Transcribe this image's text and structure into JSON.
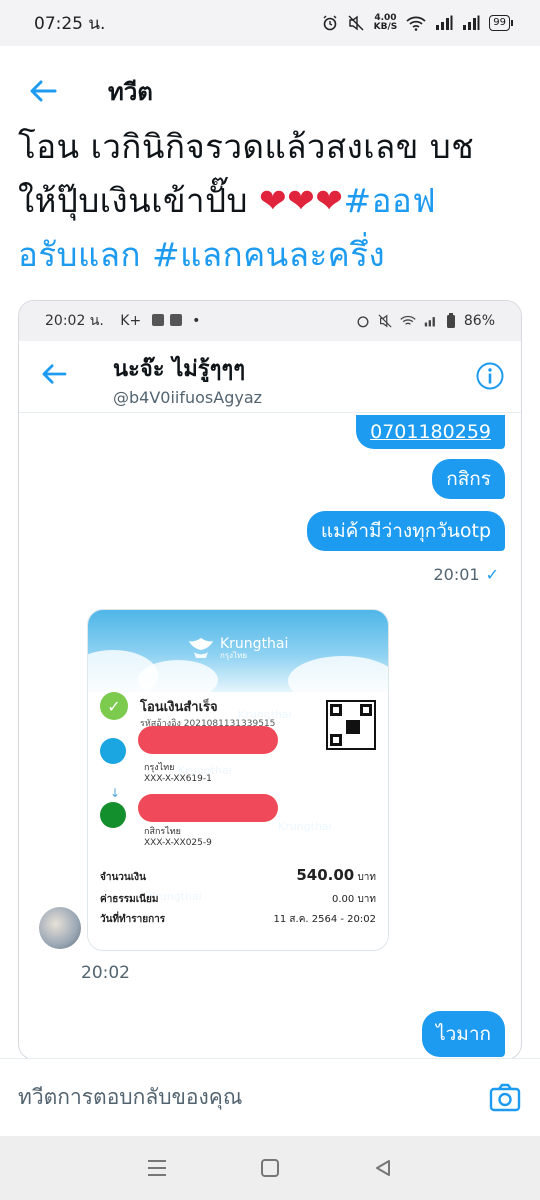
{
  "status_bar": {
    "time": "07:25 น.",
    "speed_value": "4.00",
    "speed_unit": "KB/S",
    "battery": "99"
  },
  "header": {
    "title": "ทวีต"
  },
  "tweet": {
    "line1": "โอน เวกินิกิจรวดแล้วสงเลข บช",
    "line2": "ให้ปุ๊บเงินเข้าปั๊บ",
    "hearts": "❤❤❤",
    "tag1_part": "#ออฟ",
    "tag1_rest": "อรับแลก",
    "tag2": "#แลกคนละครึ่ง"
  },
  "screenshot": {
    "status_time": "20:02 น.",
    "status_k": "K+",
    "battery": "86%",
    "name": "นะจ๊ะ ไม่รู้ๆๆๆ",
    "handle": "@b4V0iifuosAgyaz",
    "messages": {
      "account_number": "0701180259",
      "bank": "กสิกร",
      "note": "แม่ค้ามีว่างทุกวันotp",
      "sent_time": "20:01",
      "last": "ไวมาก"
    },
    "received_time": "20:02",
    "receipt": {
      "brand": "Krungthai",
      "brand_sub": "กรุงไทย",
      "status": "โอนเงินสำเร็จ",
      "ref": "รหัสอ้างอิง 2021081131339515",
      "from_bank": "กรุงไทย",
      "from_account": "XXX-X-XX619-1",
      "to_bank": "กสิกรไทย",
      "to_account": "XXX-X-XX025-9",
      "amount_label": "จำนวนเงิน",
      "amount": "540.00",
      "amount_unit": "บาท",
      "fee_label": "ค่าธรรมเนียม",
      "fee": "0.00 บาท",
      "date_label": "วันที่ทำรายการ",
      "date": "11 ส.ค. 2564 - 20:02",
      "watermark": "Krungthai"
    }
  },
  "reply": {
    "placeholder": "ทวีตการตอบกลับของคุณ"
  },
  "colors": {
    "accent": "#1d9bf0",
    "heart": "#e0243c",
    "redaction": "#f04a5a"
  }
}
